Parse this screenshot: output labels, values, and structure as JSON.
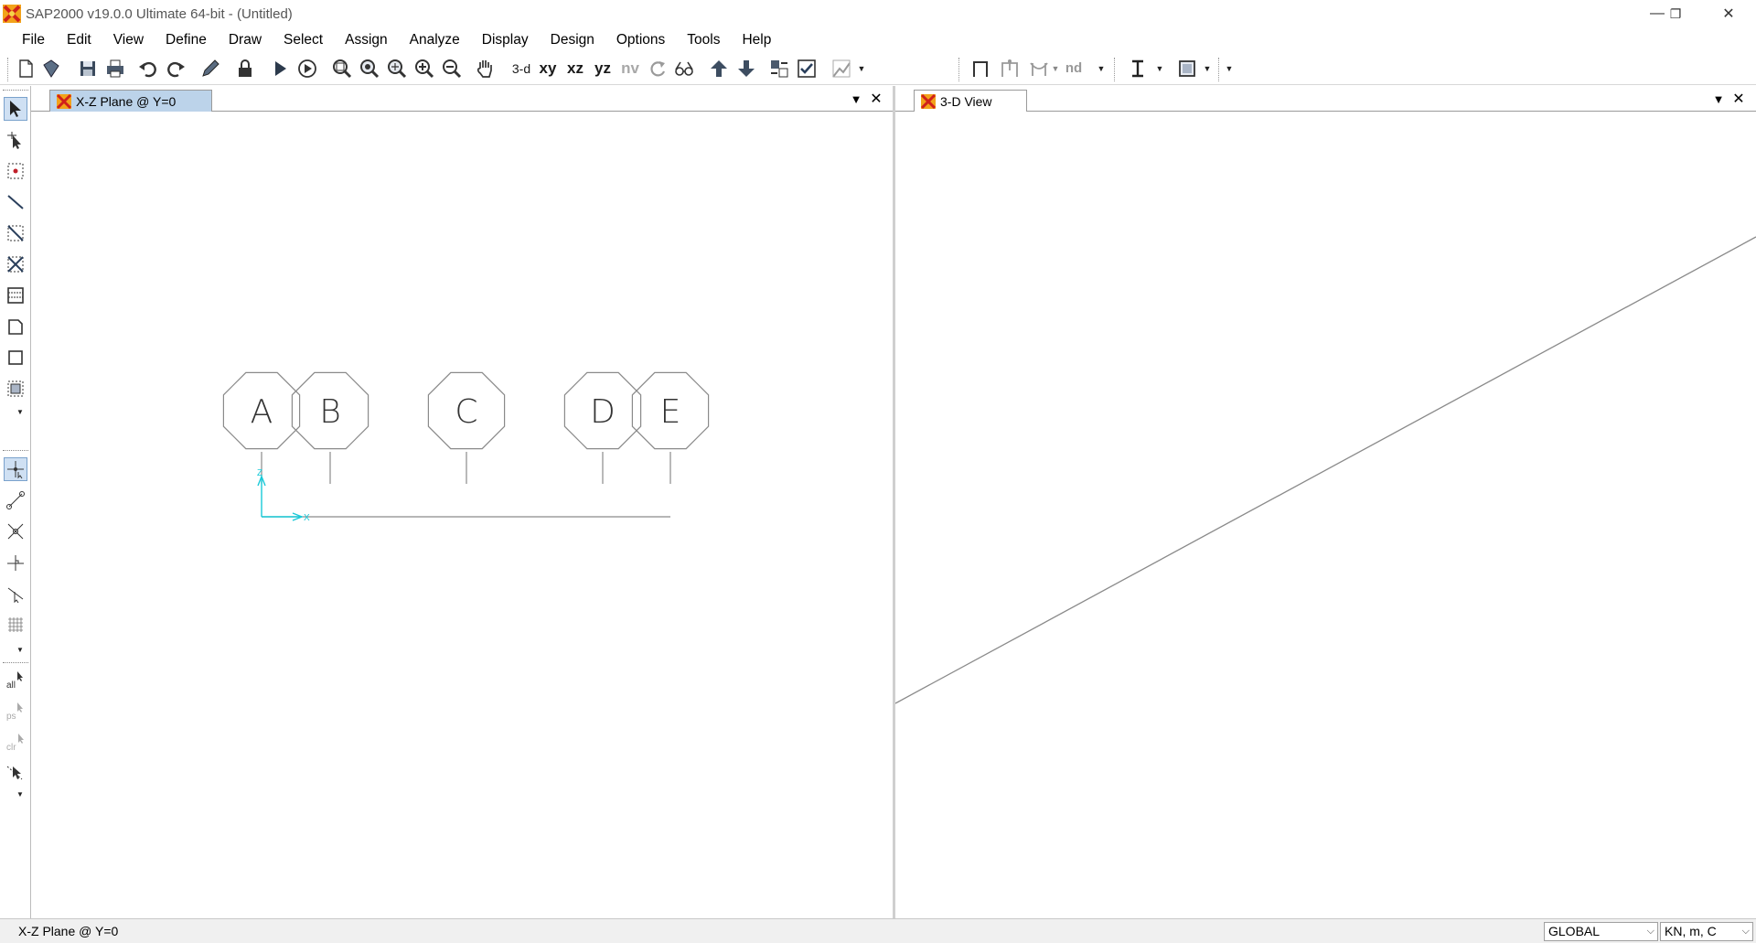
{
  "window": {
    "title": "SAP2000 v19.0.0 Ultimate 64-bit - (Untitled)",
    "minimize": "—",
    "restore": "❐",
    "close": "✕"
  },
  "menu": [
    "File",
    "Edit",
    "View",
    "Define",
    "Draw",
    "Select",
    "Assign",
    "Analyze",
    "Display",
    "Design",
    "Options",
    "Tools",
    "Help"
  ],
  "toolbar": {
    "view_3d": "3-d",
    "view_xy": "xy",
    "view_xz": "xz",
    "view_yz": "yz",
    "view_nv": "nv",
    "nd_label": "nd"
  },
  "left_panel": {
    "tab_title": "X-Z Plane @ Y=0",
    "grid_labels": [
      "A",
      "B",
      "C",
      "D",
      "E"
    ],
    "axis_z": "Z",
    "axis_x": "X"
  },
  "right_panel": {
    "tab_title": "3-D View"
  },
  "statusbar": {
    "text": "X-Z Plane @ Y=0",
    "coord_system": "GLOBAL",
    "units": "KN, m, C"
  },
  "colors": {
    "annotation": "#e0202c",
    "axis": "#19c9d8",
    "active_tab": "#bcd3ea",
    "grid_line": "#8a8a8a"
  }
}
